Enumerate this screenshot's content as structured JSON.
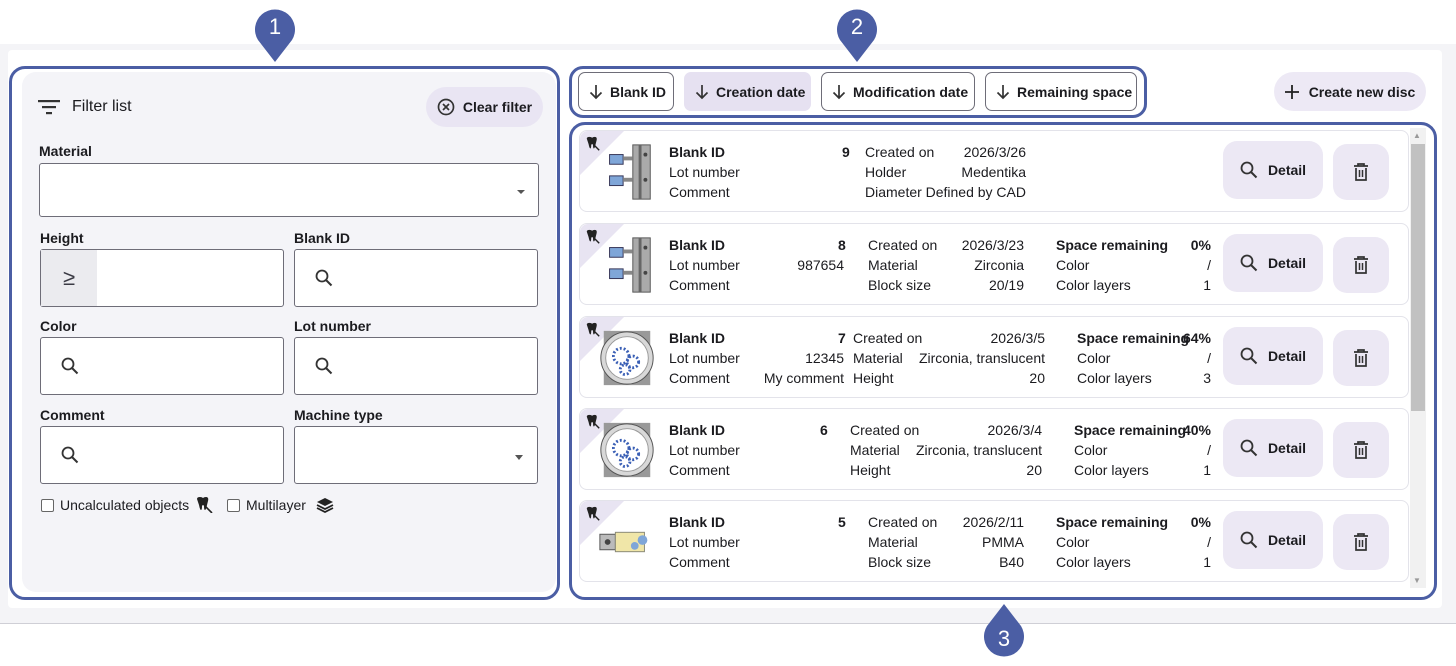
{
  "filter": {
    "title": "Filter list",
    "clear_label": "Clear filter",
    "material_label": "Material",
    "height_label": "Height",
    "height_operator": "≥",
    "blank_id_label": "Blank ID",
    "color_label": "Color",
    "lot_number_label": "Lot number",
    "comment_label": "Comment",
    "machine_type_label": "Machine type",
    "uncalculated_label": "Uncalculated objects",
    "multilayer_label": "Multilayer"
  },
  "sort": {
    "buttons": [
      "Blank ID",
      "Creation date",
      "Modification date",
      "Remaining space"
    ],
    "active": "Creation date"
  },
  "create_label": "Create new disc",
  "detail_label": "Detail",
  "callouts": [
    "1",
    "2",
    "3"
  ],
  "discs": [
    {
      "blank_id_label": "Blank ID",
      "blank_id": "9",
      "lot_label": "Lot number",
      "lot": "",
      "comment_label": "Comment",
      "comment": "",
      "c2": [
        [
          "Created on",
          "2026/3/26"
        ],
        [
          "Holder",
          "Medentika"
        ],
        [
          "Diameter",
          "Defined by CAD"
        ]
      ],
      "c3": []
    },
    {
      "blank_id_label": "Blank ID",
      "blank_id": "8",
      "lot_label": "Lot number",
      "lot": "987654",
      "comment_label": "Comment",
      "comment": "",
      "c2": [
        [
          "Created on",
          "2026/3/23"
        ],
        [
          "Material",
          "Zirconia"
        ],
        [
          "Block size",
          "20/19"
        ]
      ],
      "c3": [
        [
          "Space remaining",
          "0%"
        ],
        [
          "Color",
          "/"
        ],
        [
          "Color layers",
          "1"
        ]
      ]
    },
    {
      "blank_id_label": "Blank ID",
      "blank_id": "7",
      "lot_label": "Lot number",
      "lot": "12345",
      "comment_label": "Comment",
      "comment": "My comment",
      "c2": [
        [
          "Created on",
          "2026/3/5"
        ],
        [
          "Material",
          "Zirconia, translucent"
        ],
        [
          "Height",
          "20"
        ]
      ],
      "c3": [
        [
          "Space remaining",
          "64%"
        ],
        [
          "Color",
          "/"
        ],
        [
          "Color layers",
          "3"
        ]
      ]
    },
    {
      "blank_id_label": "Blank ID",
      "blank_id": "6",
      "lot_label": "Lot number",
      "lot": "",
      "comment_label": "Comment",
      "comment": "",
      "c2": [
        [
          "Created on",
          "2026/3/4"
        ],
        [
          "Material",
          "Zirconia, translucent"
        ],
        [
          "Height",
          "20"
        ]
      ],
      "c3": [
        [
          "Space remaining",
          "40%"
        ],
        [
          "Color",
          "/"
        ],
        [
          "Color layers",
          "1"
        ]
      ]
    },
    {
      "blank_id_label": "Blank ID",
      "blank_id": "5",
      "lot_label": "Lot number",
      "lot": "",
      "comment_label": "Comment",
      "comment": "",
      "c2": [
        [
          "Created on",
          "2026/2/11"
        ],
        [
          "Material",
          "PMMA"
        ],
        [
          "Block size",
          "B40"
        ]
      ],
      "c3": [
        [
          "Space remaining",
          "0%"
        ],
        [
          "Color",
          "/"
        ],
        [
          "Color layers",
          "1"
        ]
      ]
    }
  ],
  "colors": {
    "accent": "#4b5ea4",
    "chip": "#e6e1f1",
    "bg": "#f4f4f8"
  }
}
